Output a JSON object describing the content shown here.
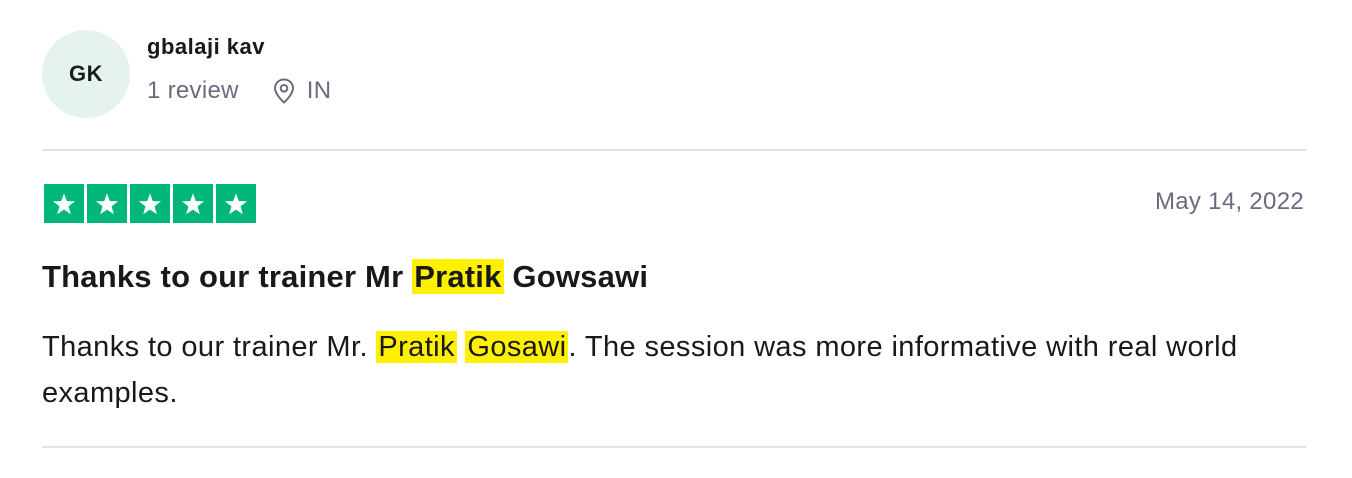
{
  "reviewer": {
    "initials": "GK",
    "name": "gbalaji kav",
    "review_count": "1 review",
    "country": "IN"
  },
  "rating": {
    "stars": 5,
    "max_stars": 5,
    "color": "#00b67a"
  },
  "review": {
    "date": "May 14, 2022",
    "title": {
      "pre": "Thanks to our trainer Mr",
      "highlight": "Pratik",
      "post": "Gowsawi"
    },
    "body": {
      "pre": "Thanks to our trainer Mr.",
      "highlight1": "Pratik",
      "highlight2": "Gosawi",
      "post": ". The session was more informative with real world examples."
    }
  },
  "colors": {
    "highlight": "#fff000",
    "avatar_bg": "#e5f2ee",
    "muted_text": "#6b6b80"
  },
  "icons": {
    "location": "map-pin-icon",
    "star": "star-icon"
  }
}
